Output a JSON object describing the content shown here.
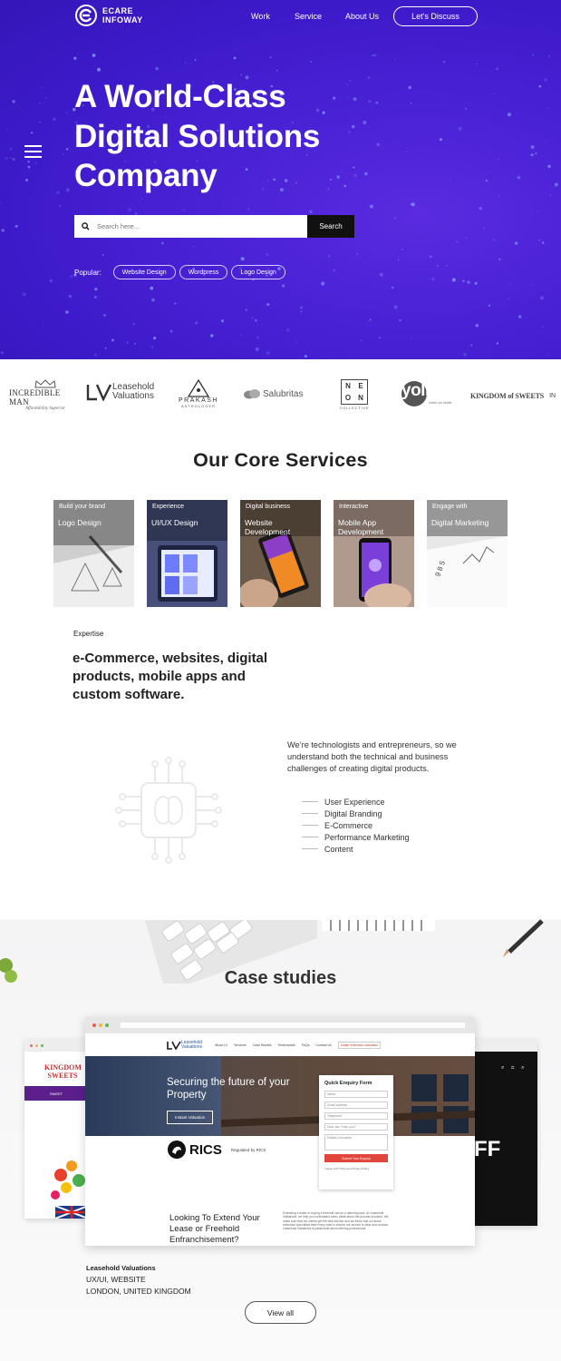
{
  "brand": {
    "line1": "ECARE",
    "line2": "INFOWAY"
  },
  "nav": {
    "work": "Work",
    "service": "Service",
    "about": "About Us",
    "cta": "Let's Discuss"
  },
  "hero": {
    "title_line1": "A World-Class",
    "title_line2": "Digital Solutions",
    "title_line3": "Company",
    "search_placeholder": "Search here...",
    "search_button": "Search",
    "popular_label": "Popular:",
    "tags": [
      "Website Design",
      "Wordpress",
      "Logo Design"
    ]
  },
  "clients": {
    "incredible_man": {
      "name": "INCREDIBLE MAN",
      "tagline": "Affordability Superior"
    },
    "leasehold": {
      "line1": "Leasehold",
      "line2": "Valuations"
    },
    "prakash": {
      "name": "PRAKASH",
      "sub": "ASTROLOGER"
    },
    "salubritas": {
      "name": "Salubritas"
    },
    "neon": {
      "letters": [
        "N",
        "E",
        "O",
        "N"
      ],
      "sub": "COLLECTIVE"
    },
    "yolife": {
      "name": "yolife",
      "sub": "inside out health"
    },
    "kingdom": {
      "name": "KINGDOM of SWEETS",
      "extra": "IN"
    }
  },
  "services": {
    "title": "Our Core Services",
    "cards": [
      {
        "sub": "Build your brand",
        "title": "Logo Design"
      },
      {
        "sub": "Experience",
        "title": "UI/UX Design"
      },
      {
        "sub": "Digital business",
        "title": "Website Development"
      },
      {
        "sub": "Interactive",
        "title": "Mobile App Development"
      },
      {
        "sub": "Engage with",
        "title": "Digital Marketing"
      }
    ]
  },
  "expertise": {
    "label": "Expertise",
    "title": "e-Commerce, websites, digital products, mobile apps and custom software.",
    "description": "We’re technologists and entrepreneurs, so we understand both the technical and business challenges of creating digital products.",
    "items": [
      "User Experience",
      "Digital Branding",
      "E-Commerce",
      "Performance Marketing",
      "Content"
    ]
  },
  "case_studies": {
    "title": "Case studies",
    "preview": {
      "logo_line1": "Leasehold",
      "logo_line2": "Valuations",
      "menu": [
        "About LV",
        "Services",
        "Case Studies",
        "Testimonials",
        "FAQs",
        "Contact Us"
      ],
      "calc": "Lease extension calculator",
      "hero_heading": "Securing the future of your Property",
      "hero_button": "Instant Valuation",
      "form_title": "Quick Enquiry Form",
      "form_fields": [
        "Name",
        "Email address",
        "Telephone",
        "How can I help you?",
        "Details of enquiry"
      ],
      "form_submit": "Submit Your Enquiry",
      "form_consent": "I agree with T&Cs and Privacy Policy",
      "rics": "RICS",
      "rics_note": "Regulated by RICS",
      "extend_heading": "Looking To Extend Your Lease or Freehold Enfranchisement?",
      "extend_text": "Extending a lease or buying a freehold can be a daunting task. At Leasehold Valuations, we help you understand every detail about the process involved. We make sure that our clients get the best service and we thrive that our lease extension specialists take every case to ensure our service is clear and concise. Leasehold Valuations is passionate about offering professional.",
      "left_name": "KINGDOM SWEETS",
      "left_bar": "SWEET",
      "right_text": "FF"
    },
    "project_name": "Leasehold Valuations",
    "project_type": "UX/UI, WEBSITE",
    "project_location": "LONDON, UNITED KINGDOM",
    "view_all": "View all"
  }
}
